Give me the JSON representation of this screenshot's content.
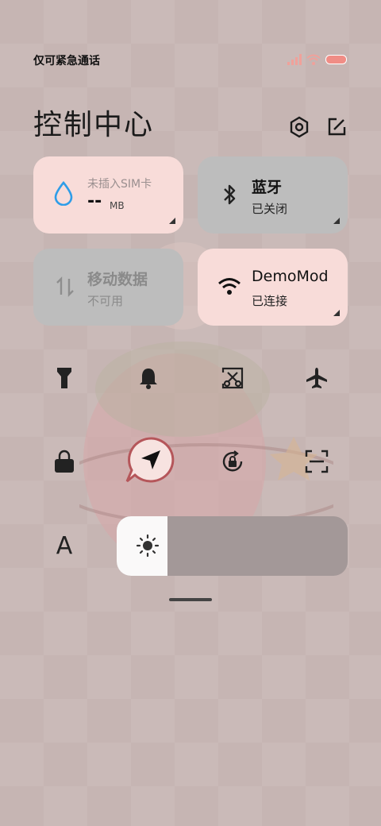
{
  "status_bar": {
    "carrier_text": "仅可紧急通话",
    "icons": [
      "signal-icon",
      "wifi-icon",
      "battery-icon"
    ]
  },
  "header": {
    "title": "控制中心",
    "icons": [
      "settings-icon",
      "edit-icon"
    ]
  },
  "tiles": {
    "data_usage": {
      "sublabel": "未插入SIM卡",
      "value": "--",
      "unit": "MB",
      "icon": "water-drop-icon"
    },
    "bluetooth": {
      "label": "蓝牙",
      "status": "已关闭",
      "icon": "bluetooth-icon"
    },
    "mobile_data": {
      "label": "移动数据",
      "status": "不可用",
      "icon": "mobile-data-icon"
    },
    "wifi": {
      "label": "DemoMod",
      "status": "已连接",
      "icon": "wifi-icon"
    }
  },
  "quick_toggles": {
    "row1": [
      "flashlight-icon",
      "bell-icon",
      "screenshot-icon",
      "airplane-icon"
    ],
    "row2": [
      "lock-icon",
      "location-icon",
      "rotation-lock-icon",
      "scan-icon"
    ],
    "font_label": "A"
  },
  "brightness": {
    "level": 0.22,
    "icon": "brightness-icon"
  },
  "colors": {
    "pink_tile": "#f8dcd9",
    "gray_tile": "#bdbdbd",
    "wifi_blue": "#2f9de8"
  }
}
